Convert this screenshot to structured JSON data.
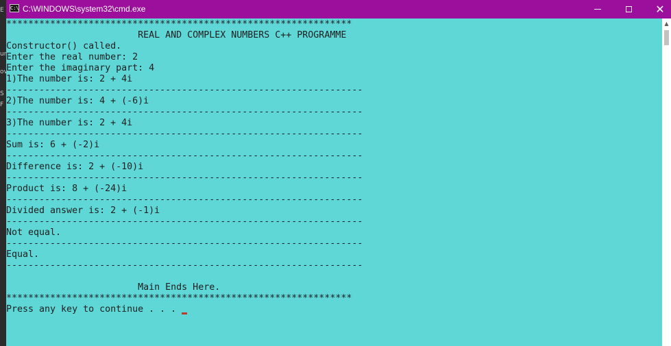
{
  "window": {
    "title": "C:\\WINDOWS\\system32\\cmd.exe",
    "icon_text": "C:\\",
    "title_bar_color": "#9c0f9c",
    "console_background": "#5fd7d7"
  },
  "behind_fragments": [
    "E",
    "ur",
    "ov",
    "S",
    "F"
  ],
  "console": {
    "lines": [
      "***************************************************************",
      "                        REAL AND COMPLEX NUMBERS C++ PROGRAMME",
      "Constructor() called.",
      "Enter the real number: 2",
      "Enter the imaginary part: 4",
      "1)The number is: 2 + 4i",
      "-----------------------------------------------------------------",
      "2)The number is: 4 + (-6)i",
      "-----------------------------------------------------------------",
      "3)The number is: 2 + 4i",
      "-----------------------------------------------------------------",
      "Sum is: 6 + (-2)i",
      "-----------------------------------------------------------------",
      "Difference is: 2 + (-10)i",
      "-----------------------------------------------------------------",
      "Product is: 8 + (-24)i",
      "-----------------------------------------------------------------",
      "Divided answer is: 2 + (-1)i",
      "-----------------------------------------------------------------",
      "Not equal.",
      "-----------------------------------------------------------------",
      "Equal.",
      "-----------------------------------------------------------------",
      "",
      "                        Main Ends Here.",
      "***************************************************************",
      "Press any key to continue . . . "
    ]
  },
  "icons": {
    "minimize": "minimize-icon",
    "maximize": "maximize-icon",
    "close": "close-icon",
    "cursor_color": "#c0392b"
  }
}
